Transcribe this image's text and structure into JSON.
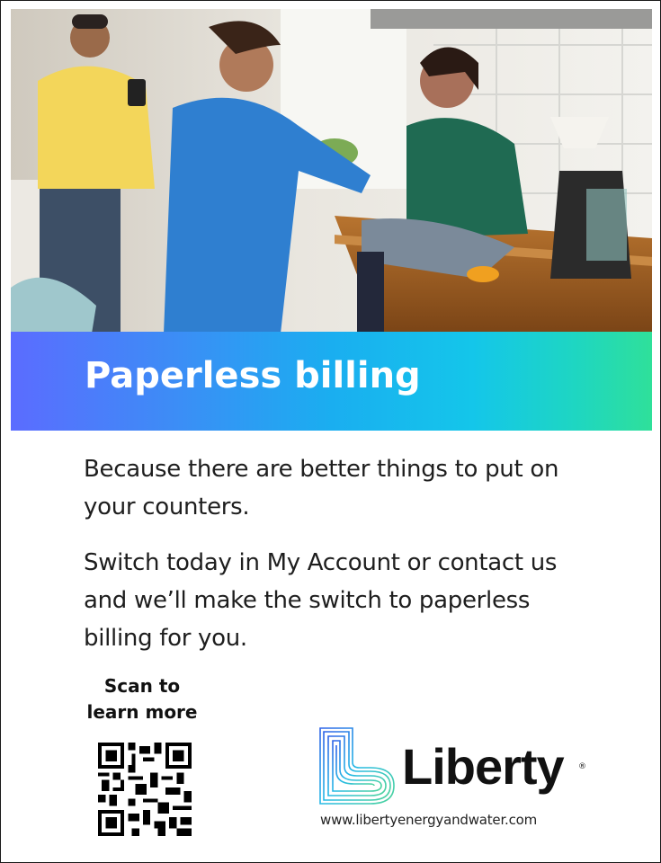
{
  "banner": {
    "title": "Paperless billing"
  },
  "body": {
    "paragraph1": "Because there are better things to put on your counters.",
    "paragraph2": "Switch today in My Account or contact us and we’ll make the switch to paperless billing for you."
  },
  "qr": {
    "caption_line1": "Scan to",
    "caption_line2": "learn more"
  },
  "brand": {
    "name": "Liberty",
    "registered_mark": "®",
    "website": "www.libertyenergyandwater.com"
  },
  "colors": {
    "banner_gradient_start": "#5b6cff",
    "banner_gradient_end": "#2fe09a",
    "text": "#1e1e1e"
  },
  "icons": [
    "family-kitchen-photo",
    "qr-code-icon",
    "liberty-heart-logo"
  ]
}
